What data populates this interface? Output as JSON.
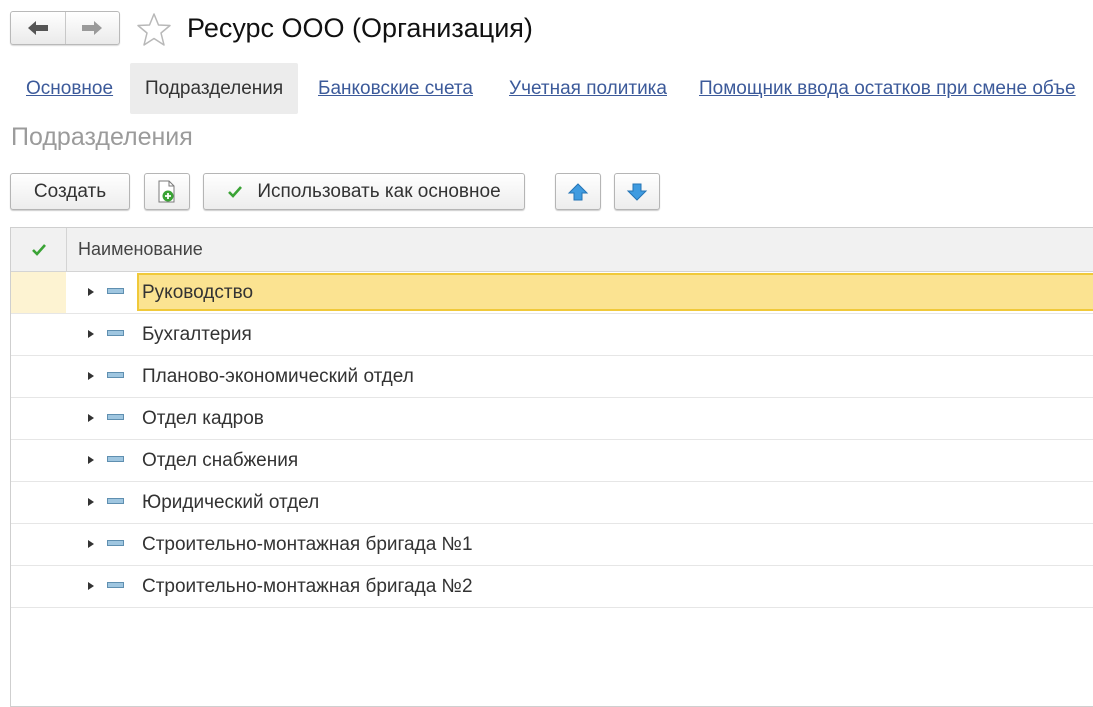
{
  "header": {
    "title": "Ресурс ООО (Организация)",
    "back_icon": "arrow-left-icon",
    "forward_icon": "arrow-right-icon",
    "favorite_icon": "star-icon"
  },
  "tabs": [
    {
      "label": "Основное",
      "active": false
    },
    {
      "label": "Подразделения",
      "active": true
    },
    {
      "label": "Банковские счета",
      "active": false
    },
    {
      "label": "Учетная политика",
      "active": false
    },
    {
      "label": "Помощник ввода остатков при смене объе",
      "active": false
    }
  ],
  "section": {
    "title": "Подразделения"
  },
  "toolbar": {
    "create_label": "Создать",
    "copy_icon": "document-add-icon",
    "use_as_main_label": "Использовать как основное",
    "move_up_icon": "arrow-up-icon",
    "move_down_icon": "arrow-down-icon"
  },
  "table": {
    "columns": [
      "Наименование"
    ],
    "rows": [
      {
        "name": "Руководство",
        "selected": true
      },
      {
        "name": "Бухгалтерия",
        "selected": false
      },
      {
        "name": "Планово-экономический отдел",
        "selected": false
      },
      {
        "name": "Отдел кадров",
        "selected": false
      },
      {
        "name": "Отдел снабжения",
        "selected": false
      },
      {
        "name": "Юридический отдел",
        "selected": false
      },
      {
        "name": "Строительно-монтажная бригада №1",
        "selected": false
      },
      {
        "name": "Строительно-монтажная бригада №2",
        "selected": false
      }
    ]
  },
  "colors": {
    "link": "#3c5a9a",
    "selected_row": "#fbe391",
    "selected_border": "#f0c93a",
    "check_green": "#3aa335",
    "arrow_blue": "#3f9be0"
  }
}
